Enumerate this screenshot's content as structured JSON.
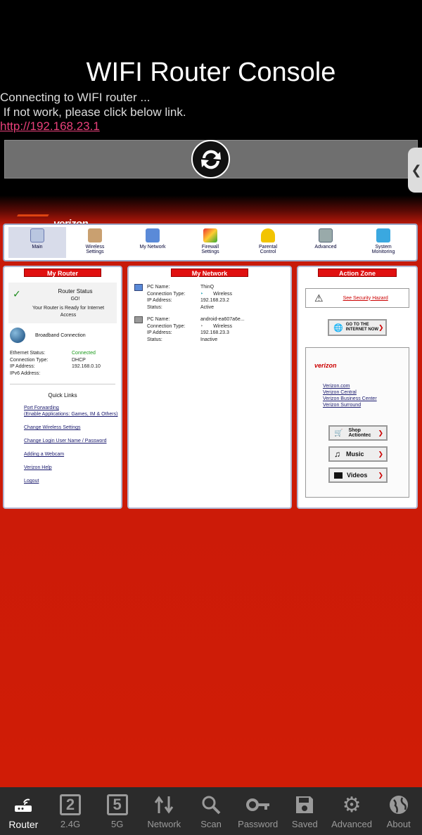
{
  "app": {
    "title": "WIFI Router Console",
    "status_line1": "Connecting to WIFI router ...",
    "status_line2": " If not work, please click below link.",
    "link": "http://192.168.23.1"
  },
  "router_page": {
    "brand": "verizon",
    "nav": [
      {
        "label": "Main",
        "icon": "main-icon",
        "active": true
      },
      {
        "label": "Wireless\nSettings",
        "icon": "wireless-settings-icon"
      },
      {
        "label": "My Network",
        "icon": "my-network-icon"
      },
      {
        "label": "Firewall\nSettings",
        "icon": "firewall-icon"
      },
      {
        "label": "Parental\nControl",
        "icon": "lock-icon"
      },
      {
        "label": "Advanced",
        "icon": "advanced-icon"
      },
      {
        "label": "System\nMonitoring",
        "icon": "monitor-icon"
      }
    ],
    "my_router": {
      "title": "My Router",
      "status_title": "Router Status",
      "status_value": "GO!",
      "status_desc": "Your Router is Ready for Internet Access",
      "broadband": "Broadband Connection",
      "fields": [
        {
          "label": "Ethernet Status:",
          "value": "Connected",
          "color": "#1a9a1a"
        },
        {
          "label": "Connection Type:",
          "value": "DHCP"
        },
        {
          "label": "IP Address:",
          "value": "192.168.0.10"
        },
        {
          "label": "IPv6 Address:",
          "value": ""
        }
      ],
      "quick_links_title": "Quick Links",
      "quick_links": [
        "Port Forwarding\n(Enable Applications: Games, IM & Others)",
        "Change Wireless Settings",
        "Change Login User Name / Password",
        "Adding a Webcam",
        "Verizon Help",
        "Logout"
      ]
    },
    "my_network": {
      "title": "My Network",
      "devices": [
        {
          "name": "ThinQ",
          "type": "Wireless",
          "ip": "192.168.23.2",
          "status": "Active"
        },
        {
          "name": "android-ea607a6e...",
          "type": "Wireless",
          "ip": "192.168.23.3",
          "status": "Inactive"
        }
      ],
      "labels": {
        "name": "PC Name:",
        "type": "Connection Type:",
        "ip": "IP Address:",
        "status": "Status:"
      }
    },
    "action_zone": {
      "title": "Action Zone",
      "hazard": "See Security Hazard",
      "internet_btn": "GO TO THE\nINTERNET NOW",
      "links": [
        "Verizon.com",
        "Verizon Central",
        "Verizon Business Center",
        "Verizon Surround"
      ],
      "buttons": [
        "Shop\nActiontec",
        "Music",
        "Videos"
      ]
    }
  },
  "tabs": [
    {
      "label": "Router",
      "icon": "router-icon",
      "active": true
    },
    {
      "label": "2.4G",
      "icon": "2",
      "glyph": "2"
    },
    {
      "label": "5G",
      "icon": "5",
      "glyph": "5"
    },
    {
      "label": "Network",
      "icon": "network-icon"
    },
    {
      "label": "Scan",
      "icon": "search-icon"
    },
    {
      "label": "Password",
      "icon": "key-icon"
    },
    {
      "label": "Saved",
      "icon": "save-icon"
    },
    {
      "label": "Advanced",
      "icon": "gear-icon"
    },
    {
      "label": "About",
      "icon": "globe-icon"
    }
  ],
  "colors": {
    "accent": "#e8407a",
    "page_red": "#d01c06",
    "panel_title": "#e01010"
  }
}
